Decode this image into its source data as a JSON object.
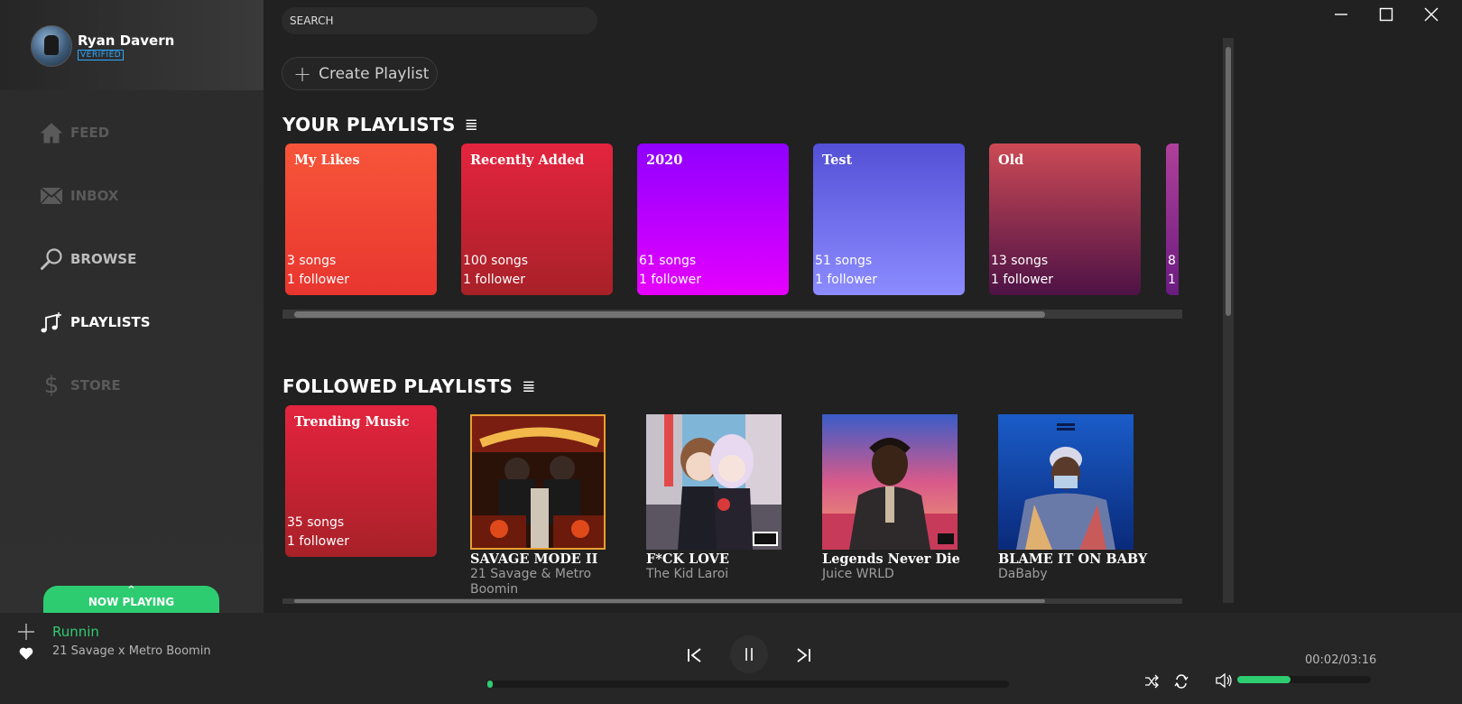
{
  "user": {
    "name": "Ryan Davern",
    "badge": "VERIFIED"
  },
  "nav": [
    {
      "label": "FEED",
      "icon": "home-icon",
      "state": "disabled"
    },
    {
      "label": "INBOX",
      "icon": "mail-icon",
      "state": "disabled"
    },
    {
      "label": "BROWSE",
      "icon": "search-icon",
      "state": "normal"
    },
    {
      "label": "PLAYLISTS",
      "icon": "playlist-icon",
      "state": "active"
    },
    {
      "label": "STORE",
      "icon": "dollar-icon",
      "state": "disabled"
    }
  ],
  "now_playing_tab": {
    "label": "NOW PLAYING",
    "caret": "^"
  },
  "search": {
    "placeholder": "SEARCH"
  },
  "create_playlist": {
    "label": "Create Playlist",
    "plus": "+"
  },
  "your_playlists": {
    "title": "YOUR PLAYLISTS",
    "list_icon": "≣",
    "items": [
      {
        "title": "My Likes",
        "songs": "3 songs",
        "followers": "1 follower",
        "color_top": "#f7553a",
        "color_bottom": "#e8362f"
      },
      {
        "title": "Recently Added",
        "songs": "100 songs",
        "followers": "1 follower",
        "color_top": "#e4243f",
        "color_bottom": "#a82128"
      },
      {
        "title": "2020",
        "songs": "61 songs",
        "followers": "1 follower",
        "color_top": "#8f00ff",
        "color_bottom": "#e600ff"
      },
      {
        "title": "Test",
        "songs": "51 songs",
        "followers": "1 follower",
        "color_top": "#5450d6",
        "color_bottom": "#8c8cff"
      },
      {
        "title": "Old",
        "songs": "13 songs",
        "followers": "1 follower",
        "color_top": "#cc4a55",
        "color_bottom": "#4d1246"
      }
    ],
    "partial_item": {
      "color_top": "#b0409a",
      "color_bottom": "#6a1c80",
      "songs_peek": "8",
      "followers_peek": "1"
    }
  },
  "followed_playlists": {
    "title": "FOLLOWED PLAYLISTS",
    "list_icon": "≣",
    "card": {
      "title": "Trending Music",
      "songs": "35 songs",
      "followers": "1 follower",
      "color_top": "#e4243f",
      "color_bottom": "#a82128"
    },
    "albums": [
      {
        "title": "SAVAGE MODE II",
        "artist": "21 Savage & Metro Boomin"
      },
      {
        "title": "F*CK LOVE",
        "artist": "The Kid Laroi"
      },
      {
        "title": "Legends Never Die",
        "artist": "Juice WRLD"
      },
      {
        "title": "BLAME IT ON BABY",
        "artist": "DaBaby"
      }
    ]
  },
  "player": {
    "track": "Runnin",
    "artist": "21 Savage x Metro Boomin",
    "time": "00:02/03:16",
    "progress_fraction": 0.008,
    "volume_fraction": 0.4,
    "accent": "#2ecc71"
  }
}
